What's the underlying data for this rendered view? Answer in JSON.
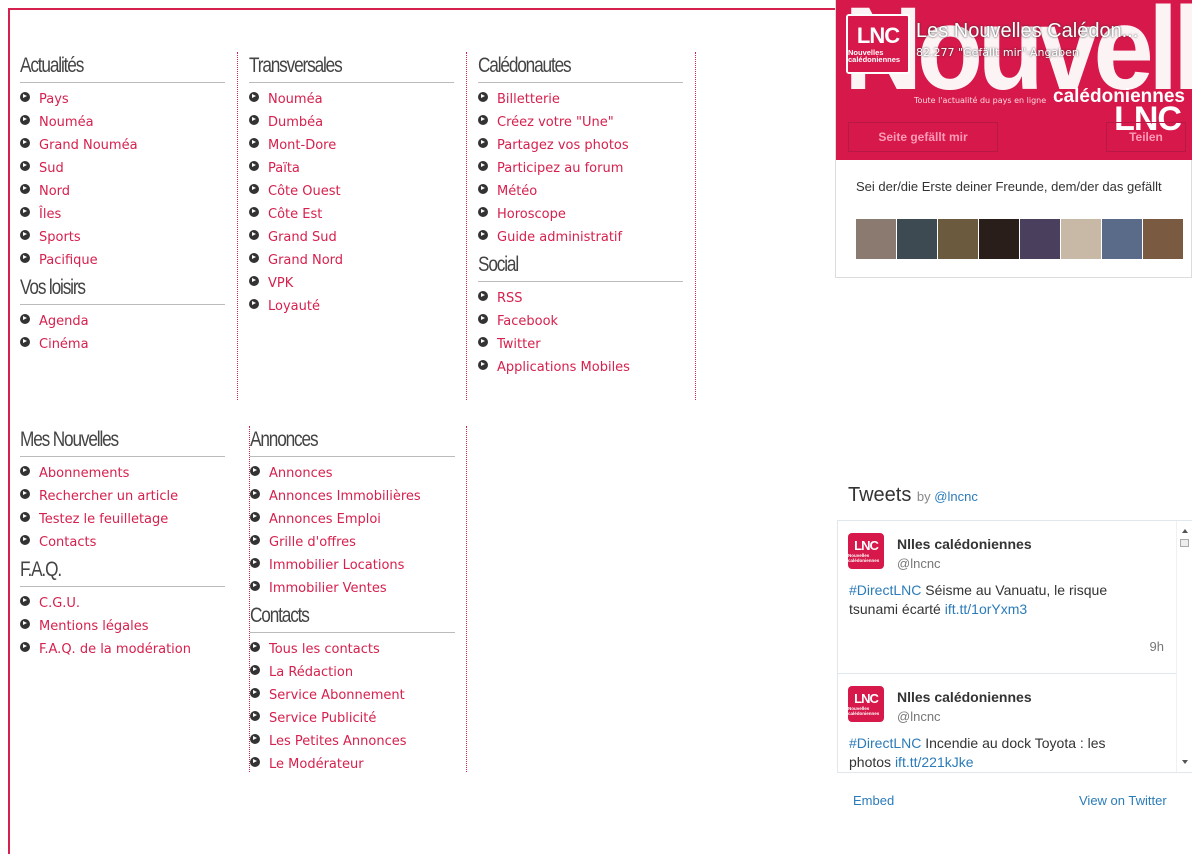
{
  "nav": {
    "actualites": {
      "title": "Actualités",
      "items": [
        "Pays",
        "Nouméa",
        "Grand Nouméa",
        "Sud",
        "Nord",
        "Îles",
        "Sports",
        "Pacifique"
      ]
    },
    "loisirs": {
      "title": "Vos loisirs",
      "items": [
        "Agenda",
        "Cinéma"
      ]
    },
    "transversales": {
      "title": "Transversales",
      "items": [
        "Nouméa",
        "Dumbéa",
        "Mont-Dore",
        "Païta",
        "Côte Ouest",
        "Côte Est",
        "Grand Sud",
        "Grand Nord",
        "VPK",
        "Loyauté"
      ]
    },
    "caledonautes": {
      "title": "Calédonautes",
      "items": [
        "Billetterie",
        "Créez votre \"Une\"",
        "Partagez vos photos",
        "Participez au forum",
        "Météo",
        "Horoscope",
        "Guide administratif"
      ]
    },
    "social": {
      "title": "Social",
      "items": [
        "RSS",
        "Facebook",
        "Twitter",
        "Applications Mobiles"
      ]
    },
    "mes_nouvelles": {
      "title": "Mes Nouvelles",
      "items": [
        "Abonnements",
        "Rechercher un article",
        "Testez le feuilletage",
        "Contacts"
      ]
    },
    "faq": {
      "title": "F.A.Q.",
      "items": [
        "C.G.U.",
        "Mentions légales",
        "F.A.Q. de la modération"
      ]
    },
    "annonces": {
      "title": "Annonces",
      "items": [
        "Annonces",
        "Annonces Immobilières",
        "Annonces Emploi",
        "Grille d'offres",
        "Immobilier Locations",
        "Immobilier Ventes"
      ]
    },
    "contacts": {
      "title": "Contacts",
      "items": [
        "Tous les contacts",
        "La Rédaction",
        "Service Abonnement",
        "Service Publicité",
        "Les Petites Annonces",
        "Le Modérateur"
      ]
    }
  },
  "facebook": {
    "page_name": "Les Nouvelles Calédon...",
    "likes": "82.277 \"Gefällt mir\"-Angaben",
    "like_button": "Seite gefällt mir",
    "share_button": "Teilen",
    "cover_text": "Nouvelles",
    "cover_tagline": "Toute l'actualité du pays en ligne",
    "cover_caledoniennes": "calédoniennes",
    "cover_lnc": "LNC",
    "logo_lnc": "LNC",
    "logo_sub": "Nouvelles calédoniennes",
    "friends_text": "Sei der/die Erste deiner Freunde, dem/der das gefällt",
    "face_colors": [
      "#8a7a70",
      "#3d4a52",
      "#6b5a3e",
      "#2a1e1a",
      "#4a3f5c",
      "#c8b8a6",
      "#5a6b8a",
      "#7a5a40"
    ]
  },
  "twitter": {
    "heading": "Tweets",
    "by": "by",
    "by_handle": "@lncnc",
    "tweets": [
      {
        "name": "Nlles calédoniennes",
        "handle": "@lncnc",
        "hashtag": "#DirectLNC",
        "text": " Séisme au Vanuatu, le risque tsunami écarté ",
        "link": "ift.tt/1orYxm3",
        "time": "9h"
      },
      {
        "name": "Nlles calédoniennes",
        "handle": "@lncnc",
        "hashtag": "#DirectLNC",
        "text": " Incendie au dock Toyota : les photos ",
        "link": "ift.tt/221kJke",
        "time": ""
      }
    ],
    "embed": "Embed",
    "view_on_twitter": "View on Twitter"
  },
  "colors": {
    "accent": "#d6204d",
    "link_blue": "#2b7bb9"
  }
}
